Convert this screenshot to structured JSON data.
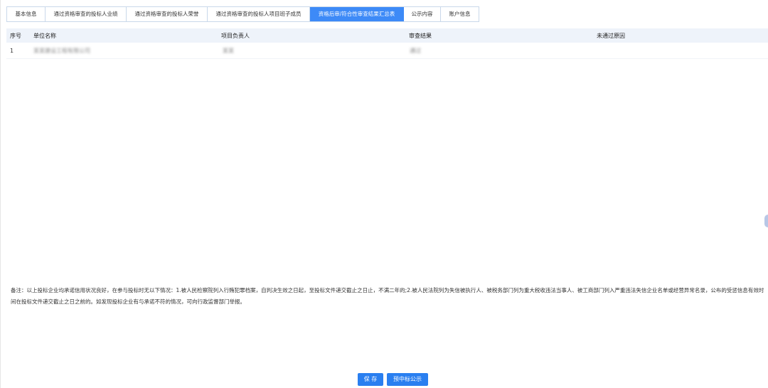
{
  "tabs": [
    {
      "label": "基本信息",
      "active": false
    },
    {
      "label": "通过资格审查的投标人业绩",
      "active": false
    },
    {
      "label": "通过资格审查的投标人荣誉",
      "active": false
    },
    {
      "label": "通过资格审查的投标人项目班子成员",
      "active": false
    },
    {
      "label": "资格后审/符合性审查结果汇总表",
      "active": true
    },
    {
      "label": "公示内容",
      "active": false
    },
    {
      "label": "账户信息",
      "active": false
    }
  ],
  "table": {
    "headers": [
      "序号",
      "单位名称",
      "项目负责人",
      "审查结果",
      "未通过原因"
    ],
    "rows": [
      {
        "index": "1",
        "company": "某某建设工程有限公司",
        "manager": "某某",
        "result": "通过",
        "reason": ""
      }
    ]
  },
  "note": {
    "text": "备注：以上投标企业均承诺信用状况良好，在参与投标时无以下情况：1.被人民检察院列入行贿犯罪档案，自判决生效之日起，至投标文件递交截止之日止，不满二年的;2.被人民法院列为失信被执行人、被税务部门列为重大税收违法当事人、被工商部门列入严重违法失信企业名单或经营异常名录，公布的受惩信息有效时间在投标文件递交截止之日之前的。如发现投标企业有与承诺不符的情况，可向行政监督部门举报。"
  },
  "buttons": {
    "save": "保 存",
    "publish": "预中标公示"
  },
  "colors": {
    "accent": "#3d8af7",
    "header_bg": "#eef3fa"
  }
}
